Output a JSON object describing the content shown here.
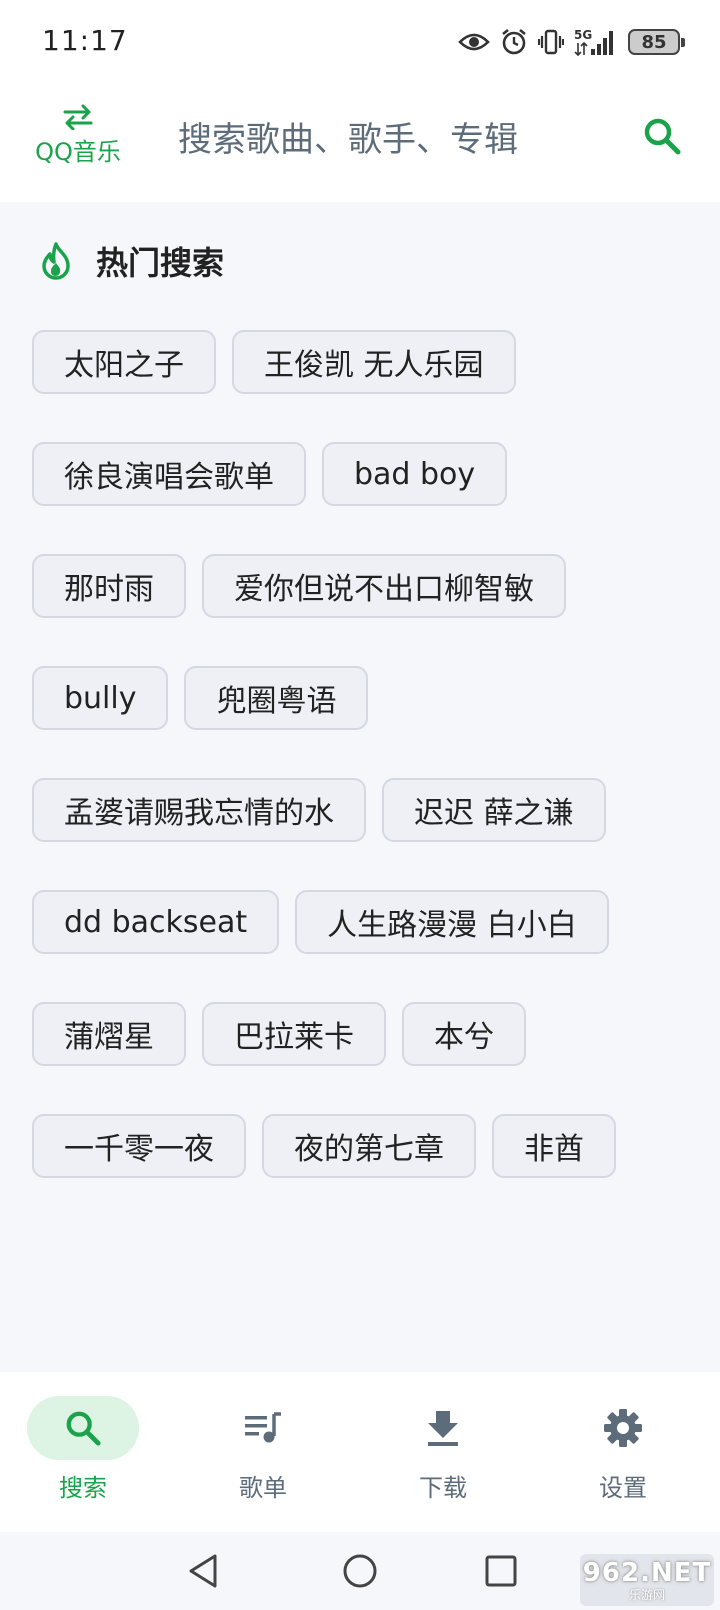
{
  "status_bar": {
    "time": "11:17",
    "network_label": "5G",
    "battery": "85",
    "icons": [
      "eye-icon",
      "alarm-icon",
      "vibrate-icon",
      "signal-icon",
      "battery-icon"
    ]
  },
  "header": {
    "brand_name": "QQ音乐",
    "brand_icon": "swap-arrows-icon",
    "search_placeholder": "搜索歌曲、歌手、专辑",
    "search_icon": "search-icon"
  },
  "hot_search": {
    "title": "热门搜索",
    "icon": "flame-icon",
    "rows": [
      [
        "太阳之子",
        "王俊凯 无人乐园"
      ],
      [
        "徐良演唱会歌单",
        "bad boy"
      ],
      [
        "那时雨",
        "爱你但说不出口柳智敏"
      ],
      [
        "bully",
        "兜圈粤语"
      ],
      [
        "孟婆请赐我忘情的水",
        "迟迟 薛之谦"
      ],
      [
        "dd backseat",
        "人生路漫漫 白小白"
      ],
      [
        "蒲熠星",
        "巴拉莱卡",
        "本兮"
      ],
      [
        "一千零一夜",
        "夜的第七章",
        "非酋"
      ]
    ]
  },
  "bottom_nav": {
    "items": [
      {
        "label": "搜索",
        "icon": "search-icon",
        "active": true
      },
      {
        "label": "歌单",
        "icon": "playlist-icon",
        "active": false
      },
      {
        "label": "下载",
        "icon": "download-icon",
        "active": false
      },
      {
        "label": "设置",
        "icon": "gear-icon",
        "active": false
      }
    ]
  },
  "colors": {
    "accent": "#1aa34a",
    "accent_light": "#ddf3e3",
    "muted_text": "#5d6c7a",
    "content_bg": "#f6f7fa",
    "chip_bg": "#eef0f5",
    "chip_border": "#d3d8e2"
  },
  "watermark": {
    "main": "962.NET",
    "sub": "乐游网"
  }
}
